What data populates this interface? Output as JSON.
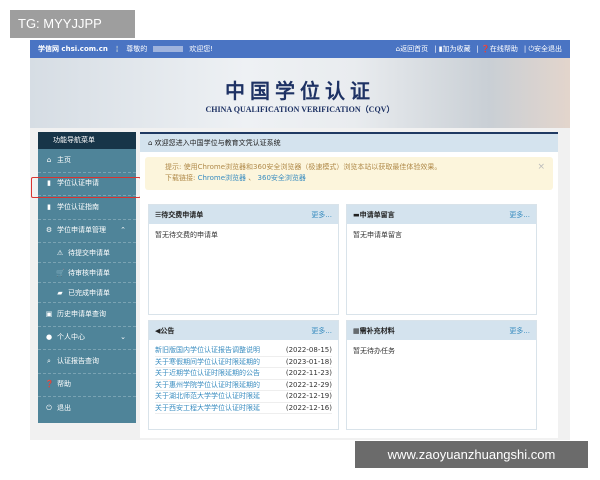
{
  "watermarks": {
    "top_left": "TG: MYYJJPP",
    "bottom_right": "www.zaoyuanzhuangshi.com"
  },
  "topbar": {
    "site": "学信网 chsi.com.cn",
    "greeting": "尊敬的",
    "welcome": "欢迎您!",
    "links": [
      {
        "icon": "home-icon",
        "label": "返回首页"
      },
      {
        "icon": "bookmark-icon",
        "label": "加为收藏"
      },
      {
        "icon": "help-icon",
        "label": "在线帮助"
      },
      {
        "icon": "power-icon",
        "label": "安全退出"
      }
    ]
  },
  "banner": {
    "title": "中国学位认证",
    "subtitle": "CHINA QUALIFICATION VERIFICATION（CQV）"
  },
  "sidebar": {
    "header": "功能导航菜单",
    "items": [
      {
        "icon": "home-icon",
        "label": "主页"
      },
      {
        "icon": "file-icon",
        "label": "学位认证申请",
        "highlighted": true
      },
      {
        "icon": "bookmark-icon",
        "label": "学位认证指南"
      },
      {
        "icon": "gear-icon",
        "label": "学位申请单管理",
        "expanded": true
      },
      {
        "icon": "warning-icon",
        "label": "待提交申请单",
        "sub": true
      },
      {
        "icon": "cart-icon",
        "label": "待审核申请单",
        "sub": true
      },
      {
        "icon": "briefcase-icon",
        "label": "已完成申请单",
        "sub": true
      },
      {
        "icon": "camera-icon",
        "label": "历史申请单查询"
      },
      {
        "icon": "user-icon",
        "label": "个人中心"
      },
      {
        "icon": "search-icon",
        "label": "认证报告查询"
      },
      {
        "icon": "help-icon",
        "label": "帮助"
      },
      {
        "icon": "power-icon",
        "label": "退出"
      }
    ]
  },
  "main": {
    "breadcrumb": "欢迎您进入中国学位与教育文凭认证系统",
    "alert": {
      "text": "提示: 使用Chrome浏览器和360安全浏览器（极速模式）浏览本站以获取最佳体验效果。",
      "download_label": "下载链接:",
      "link1": "Chrome浏览器",
      "sep": "、",
      "link2": "360安全浏览器",
      "close": "×"
    },
    "panels": {
      "pending_payment": {
        "title": "待交费申请单",
        "more": "更多...",
        "empty": "暂无待交费的申请单"
      },
      "messages": {
        "title": "申请单留言",
        "more": "更多...",
        "empty": "暂无申请单留言"
      },
      "notices": {
        "title": "公告",
        "more": "更多...",
        "items": [
          {
            "title": "新旧版国内学位认证报告调整说明",
            "date": "(2022-08-15)"
          },
          {
            "title": "关于寒假期间学位认证时限延期的",
            "date": "(2023-01-18)"
          },
          {
            "title": "关于近期学位认证时限延期的公告",
            "date": "(2022-11-23)"
          },
          {
            "title": "关于惠州学院学位认证时限延期的",
            "date": "(2022-12-29)"
          },
          {
            "title": "关于湖北师范大学学位认证时限延",
            "date": "(2022-12-19)"
          },
          {
            "title": "关于西安工程大学学位认证时限延",
            "date": "(2022-12-16)"
          }
        ]
      },
      "supplement": {
        "title": "需补充材料",
        "more": "更多...",
        "empty": "暂无待办任务"
      }
    }
  }
}
